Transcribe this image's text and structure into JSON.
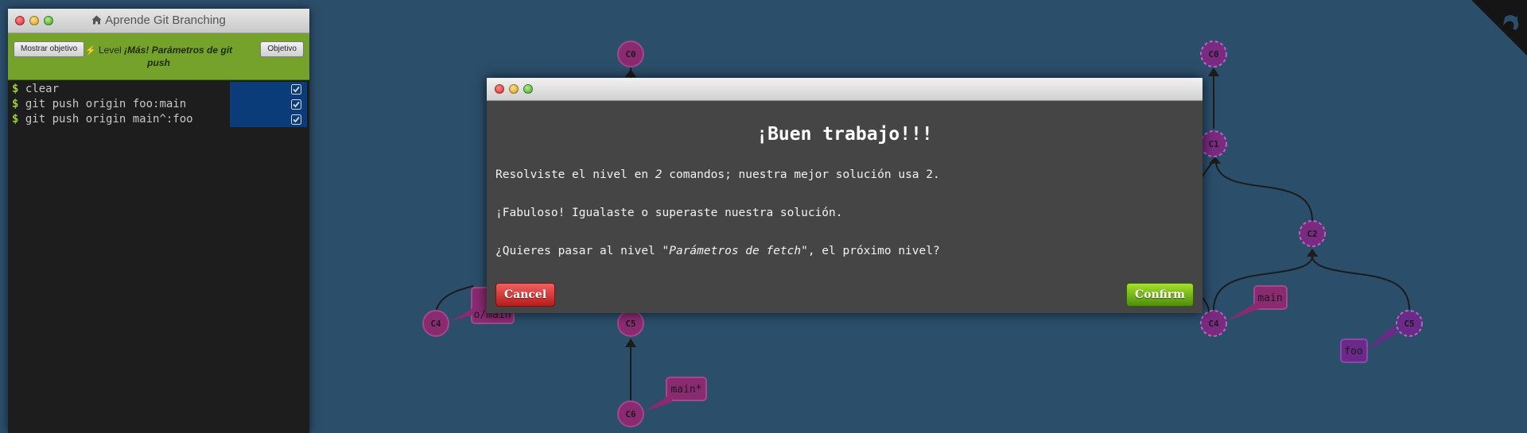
{
  "panel": {
    "title": "Aprende Git Branching",
    "goal_button": "Mostrar objetivo",
    "level_prefix": "Level",
    "level_name": "¡Más! Parámetros de git push",
    "objective_button": "Objetivo",
    "commands": [
      {
        "prompt": "$",
        "text": "clear"
      },
      {
        "prompt": "$",
        "text": "git push origin foo:main"
      },
      {
        "prompt": "$",
        "text": "git push origin main^:foo"
      }
    ]
  },
  "modal": {
    "heading": "¡Buen trabajo!!!",
    "line1_a": "Resolviste el nivel en ",
    "line1_count": "2",
    "line1_b": " comandos; nuestra mejor solución usa 2.",
    "line2": "¡Fabuloso! Igualaste o superaste nuestra solución.",
    "line3_a": "¿Quieres pasar al nivel ",
    "line3_level": "\"Parámetros de fetch\"",
    "line3_b": ", el próximo nivel?",
    "cancel_label": "Cancel",
    "confirm_label": "Confirm"
  },
  "graph": {
    "colors": {
      "background": "#2b4e6b",
      "commit": "#8a2b72",
      "commit_dashed": "#7a2a80",
      "edge": "#1c1c1c",
      "branch_tag": "#8a2b72",
      "branch_tag_purple": "#6b2a8a"
    },
    "left_commits": [
      {
        "id": "c0_left",
        "label": "C0"
      },
      {
        "id": "c4_left",
        "label": "C4"
      },
      {
        "id": "c5_left",
        "label": "C5"
      },
      {
        "id": "c6_left",
        "label": "C6"
      }
    ],
    "left_branches": [
      {
        "id": "omain_tag",
        "label": "o/main"
      },
      {
        "id": "main_star_tag",
        "label": "main*"
      }
    ],
    "right_commits": [
      {
        "id": "c0_right",
        "label": "C0"
      },
      {
        "id": "c1_right",
        "label": "C1"
      },
      {
        "id": "c2_right",
        "label": "C2"
      },
      {
        "id": "c4_right",
        "label": "C4"
      },
      {
        "id": "c5_right",
        "label": "C5"
      }
    ],
    "right_branches": [
      {
        "id": "main_tag_right",
        "label": "main"
      },
      {
        "id": "foo_tag_right",
        "label": "foo"
      }
    ]
  }
}
